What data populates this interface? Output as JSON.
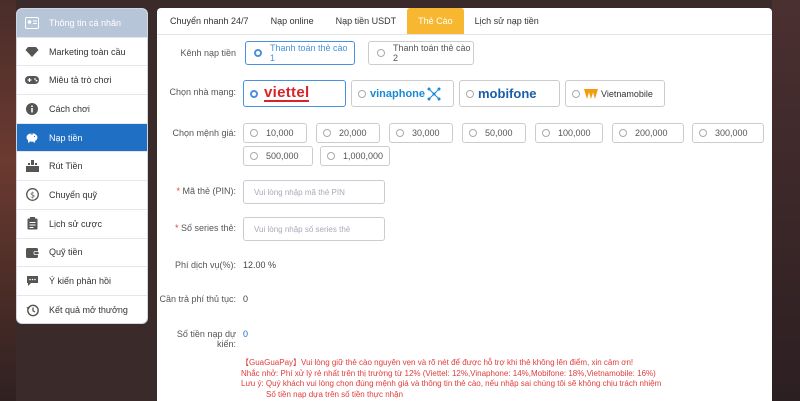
{
  "sidebar": {
    "items": [
      {
        "label": "Thông tin cá nhân",
        "icon": "user-card-icon"
      },
      {
        "label": "Marketing toàn cầu",
        "icon": "diamond-icon"
      },
      {
        "label": "Miêu tả trò chơi",
        "icon": "gamepad-icon"
      },
      {
        "label": "Cách chơi",
        "icon": "info-icon"
      },
      {
        "label": "Nạp tiền",
        "icon": "piggy-bank-icon"
      },
      {
        "label": "Rút Tiền",
        "icon": "withdraw-icon"
      },
      {
        "label": "Chuyển quỹ",
        "icon": "dollar-coin-icon"
      },
      {
        "label": "Lịch sử cược",
        "icon": "clipboard-icon"
      },
      {
        "label": "Quỹ tiền",
        "icon": "wallet-icon"
      },
      {
        "label": "Ý kiến phản hồi",
        "icon": "chat-icon"
      },
      {
        "label": "Kết quả mở thưởng",
        "icon": "history-icon"
      }
    ]
  },
  "tabs": [
    "Chuyển nhanh 24/7",
    "Nạp online",
    "Nạp tiền USDT",
    "Thẻ Cào",
    "Lịch sử nạp tiền"
  ],
  "form": {
    "channel_label": "Kênh nạp tiền",
    "channel_options": [
      "Thanh toán thẻ cào 1",
      "Thanh toán thẻ cào 2"
    ],
    "network_label": "Chọn nhà mạng:",
    "networks": [
      "viettel",
      "vinaphone",
      "mobifone",
      "Vietnamobile"
    ],
    "amount_label": "Chọn mệnh giá:",
    "amounts": [
      "10,000",
      "20,000",
      "30,000",
      "50,000",
      "100,000",
      "200,000",
      "300,000",
      "500,000",
      "1,000,000"
    ],
    "pin_label": "Mã thẻ (PIN):",
    "pin_placeholder": "Vui lòng nhập mã thẻ PIN",
    "serial_label": "Số series thẻ:",
    "serial_placeholder": "Vui lòng nhập số series thẻ",
    "fee_label": "Phí dịch vụ(%):",
    "fee_value": "12.00 %",
    "service_label": "Cần trả phí thủ tục:",
    "service_value": "0",
    "expected_label": "Số tiền nạp dự kiến:",
    "expected_value": "0"
  },
  "notes": [
    "【GuaGuaPay】Vui lòng giữ thẻ cào nguyên vẹn và rõ nét để được hỗ trợ khi thẻ không lên điểm, xin cảm ơn!",
    "Nhắc nhở: Phí xử lý rẻ nhất trên thị trường từ 12% (Viettel: 12%,Vinaphone: 14%,Mobifone: 18%,Vietnamobile: 16%)",
    "Lưu ý: Quý khách vui lòng chọn đúng mệnh giá và thông tin thẻ cào, nếu nhập sai chúng tôi sẽ không chịu trách nhiệm",
    "Số tiền nạp dựa trên số tiền thực nhận"
  ],
  "colors": {
    "accent": "#1f6fc4",
    "tab_active": "#f7b731",
    "warning": "#e03c3c",
    "viettel": "#d8232a",
    "vinaphone": "#1a8ad4",
    "mobifone": "#1b5faa",
    "vietnamobile": "#f39c12"
  }
}
